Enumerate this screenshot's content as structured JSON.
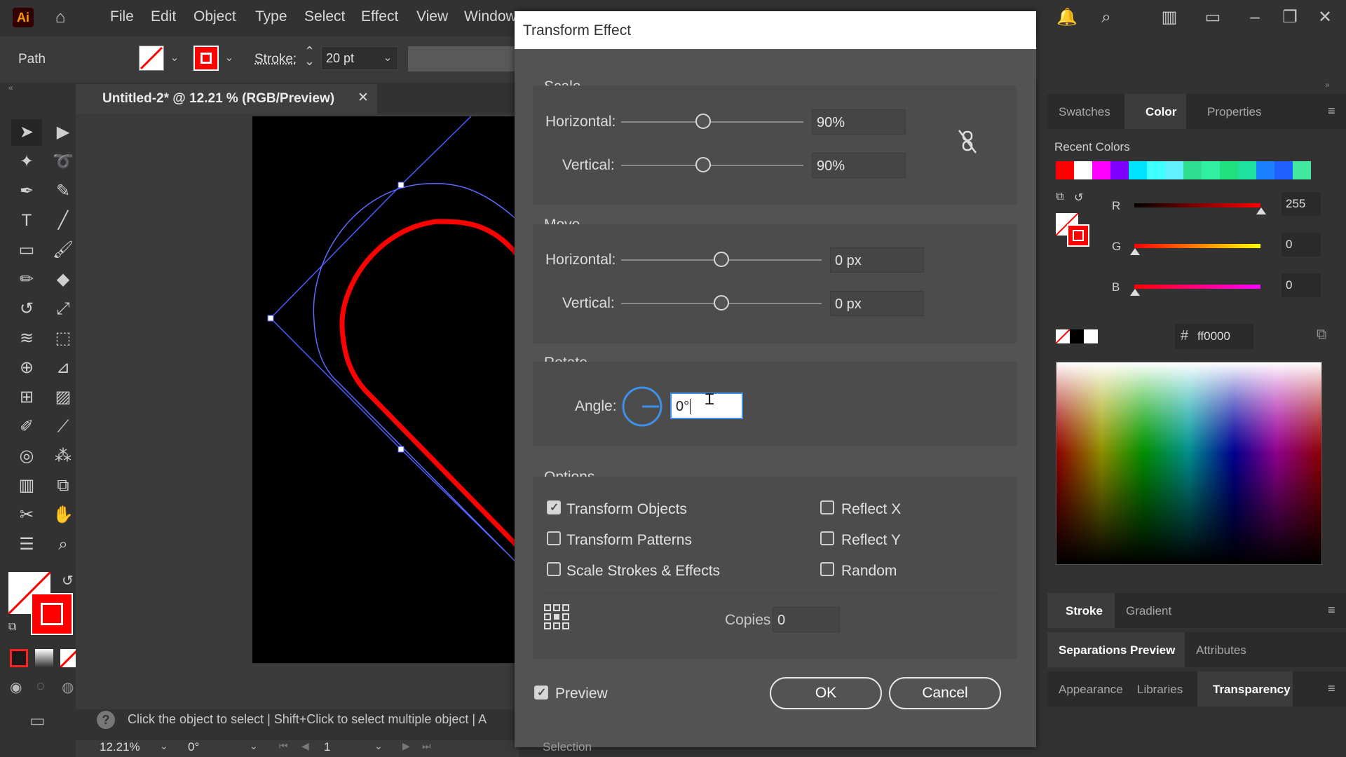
{
  "menubar": {
    "logo": "Ai",
    "items": [
      "File",
      "Edit",
      "Object",
      "Type",
      "Select",
      "Effect",
      "View",
      "Window"
    ]
  },
  "control": {
    "selection_type": "Path",
    "stroke_label": "Stroke:",
    "stroke_value": "20 pt"
  },
  "document": {
    "tab_title": "Untitled-2* @ 12.21 % (RGB/Preview)",
    "close": "✕"
  },
  "status": {
    "hint": "Click the object to select  |  Shift+Click to select multiple object  |  A",
    "zoom": "12.21%",
    "rotation": "0°",
    "artboard": "1",
    "bottom_label": "Selection"
  },
  "dialog": {
    "title": "Transform Effect",
    "scale": {
      "title": "Scale",
      "horizontal_label": "Horizontal:",
      "horizontal_value": "90%",
      "horizontal_level": 0.45,
      "vertical_label": "Vertical:",
      "vertical_value": "90%",
      "vertical_level": 0.45
    },
    "move": {
      "title": "Move",
      "horizontal_label": "Horizontal:",
      "horizontal_value": "0 px",
      "horizontal_level": 0.5,
      "vertical_label": "Vertical:",
      "vertical_value": "0 px",
      "vertical_level": 0.5
    },
    "rotate": {
      "title": "Rotate",
      "angle_label": "Angle:",
      "angle_value": "0°"
    },
    "options": {
      "title": "Options",
      "transform_objects": "Transform Objects",
      "transform_patterns": "Transform Patterns",
      "scale_strokes": "Scale Strokes & Effects",
      "reflect_x": "Reflect X",
      "reflect_y": "Reflect Y",
      "random": "Random",
      "copies_label": "Copies",
      "copies_value": "0"
    },
    "preview_label": "Preview",
    "ok_label": "OK",
    "cancel_label": "Cancel"
  },
  "panels": {
    "tabs_top": [
      "Swatches",
      "Color",
      "Properties"
    ],
    "recent_colors_label": "Recent Colors",
    "recent_colors": [
      "#ff0000",
      "#ffffff",
      "#ff00ff",
      "#8000ff",
      "#00e5ff",
      "#40ffff",
      "#60f0ff",
      "#30e090",
      "#30f0a0",
      "#20e080",
      "#20e0a0",
      "#1a80ff",
      "#2060ff",
      "#40e8a0"
    ],
    "r_label": "R",
    "r_value": "255",
    "g_label": "G",
    "g_value": "0",
    "b_label": "B",
    "b_value": "0",
    "hex_symbol": "#",
    "hex_value": "ff0000",
    "tabs_stroke": [
      "Stroke",
      "Gradient"
    ],
    "tabs_sep": [
      "Separations Preview",
      "Attributes"
    ],
    "tabs_app": [
      "Appearance",
      "Libraries",
      "Transparency"
    ]
  }
}
